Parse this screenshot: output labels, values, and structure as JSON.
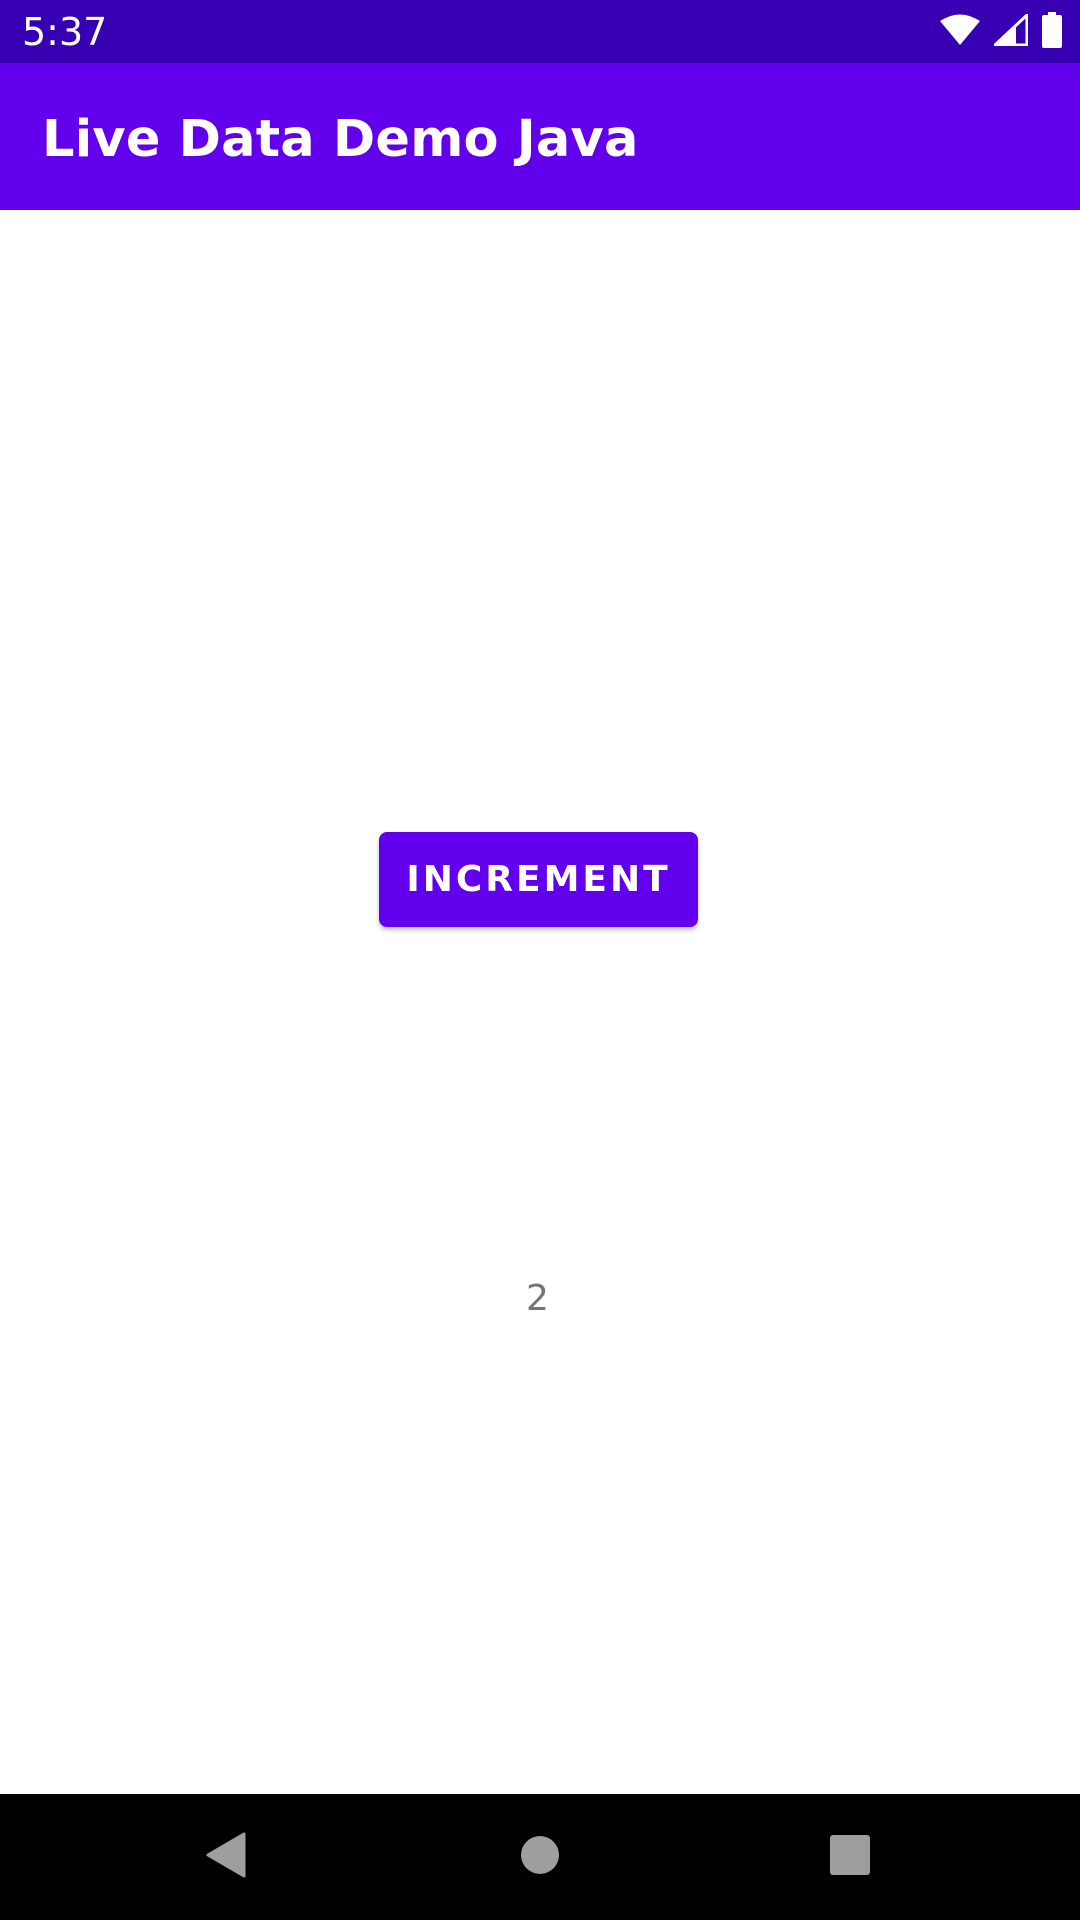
{
  "status_bar": {
    "time": "5:37",
    "icons": [
      "wifi-icon",
      "signal-icon",
      "battery-icon"
    ]
  },
  "app_bar": {
    "title": "Live Data Demo Java",
    "color": "#6200ee"
  },
  "main": {
    "increment_label": "INCREMENT",
    "counter_value": "2"
  },
  "nav_bar": {
    "icons": [
      "back-icon",
      "home-icon",
      "recents-icon"
    ]
  },
  "colors": {
    "status_bar": "#3700b3",
    "primary": "#6200ee",
    "counter_text": "#757575"
  }
}
